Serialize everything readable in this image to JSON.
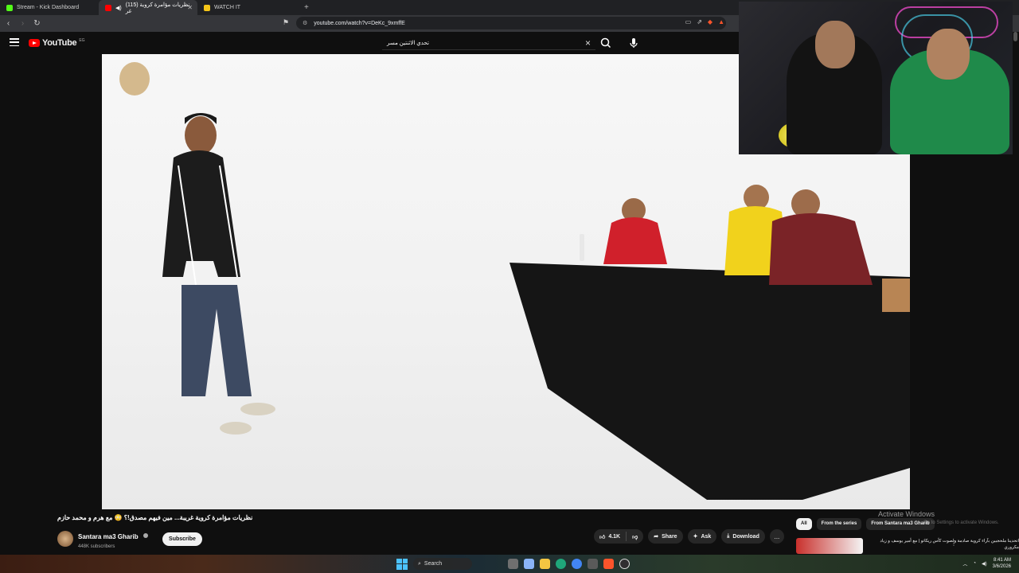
{
  "browser": {
    "tabs": [
      {
        "title": "Stream - Kick Dashboard",
        "color": "#53fc18"
      },
      {
        "title": "(115) نظريات مؤامرة كروية غر",
        "color": "#ff0000"
      },
      {
        "title": "WATCH IT",
        "color": "#f5c518"
      }
    ],
    "new_tab": "+",
    "url": "youtube.com/watch?v=DeKc_9xmffE"
  },
  "youtube": {
    "logo_text": "YouTube",
    "country_code": "EG",
    "search_value": "تحدي الاثنتين مسر",
    "video": {
      "title": "نظريات مؤامرة كروية غريبة... مين فيهم مصدق!؟ 😳 مع هرم و محمد حازم",
      "channel": "Santara ma3 Gharib",
      "subscribers": "448K subscribers",
      "subscribe_label": "Subscribe",
      "likes": "4.1K",
      "share_label": "Share",
      "ask_label": "Ask",
      "download_label": "Download",
      "more": "..."
    },
    "chips": [
      "All",
      "From the series",
      "From Santara ma3 Gharib"
    ],
    "recommendation": {
      "title": "اتحدينا ملحجبين بآراء كروية صادمة ولصوت كأس ريكاتو | مع أمير يوسف و زياد مكروري",
      "kebab": "⋮"
    }
  },
  "windows_watermark": {
    "line1": "Activate Windows",
    "line2": "Go to Settings to activate Windows."
  },
  "taskbar": {
    "search_label": "Search",
    "time": "8:41 AM",
    "date": "3/6/2026"
  }
}
